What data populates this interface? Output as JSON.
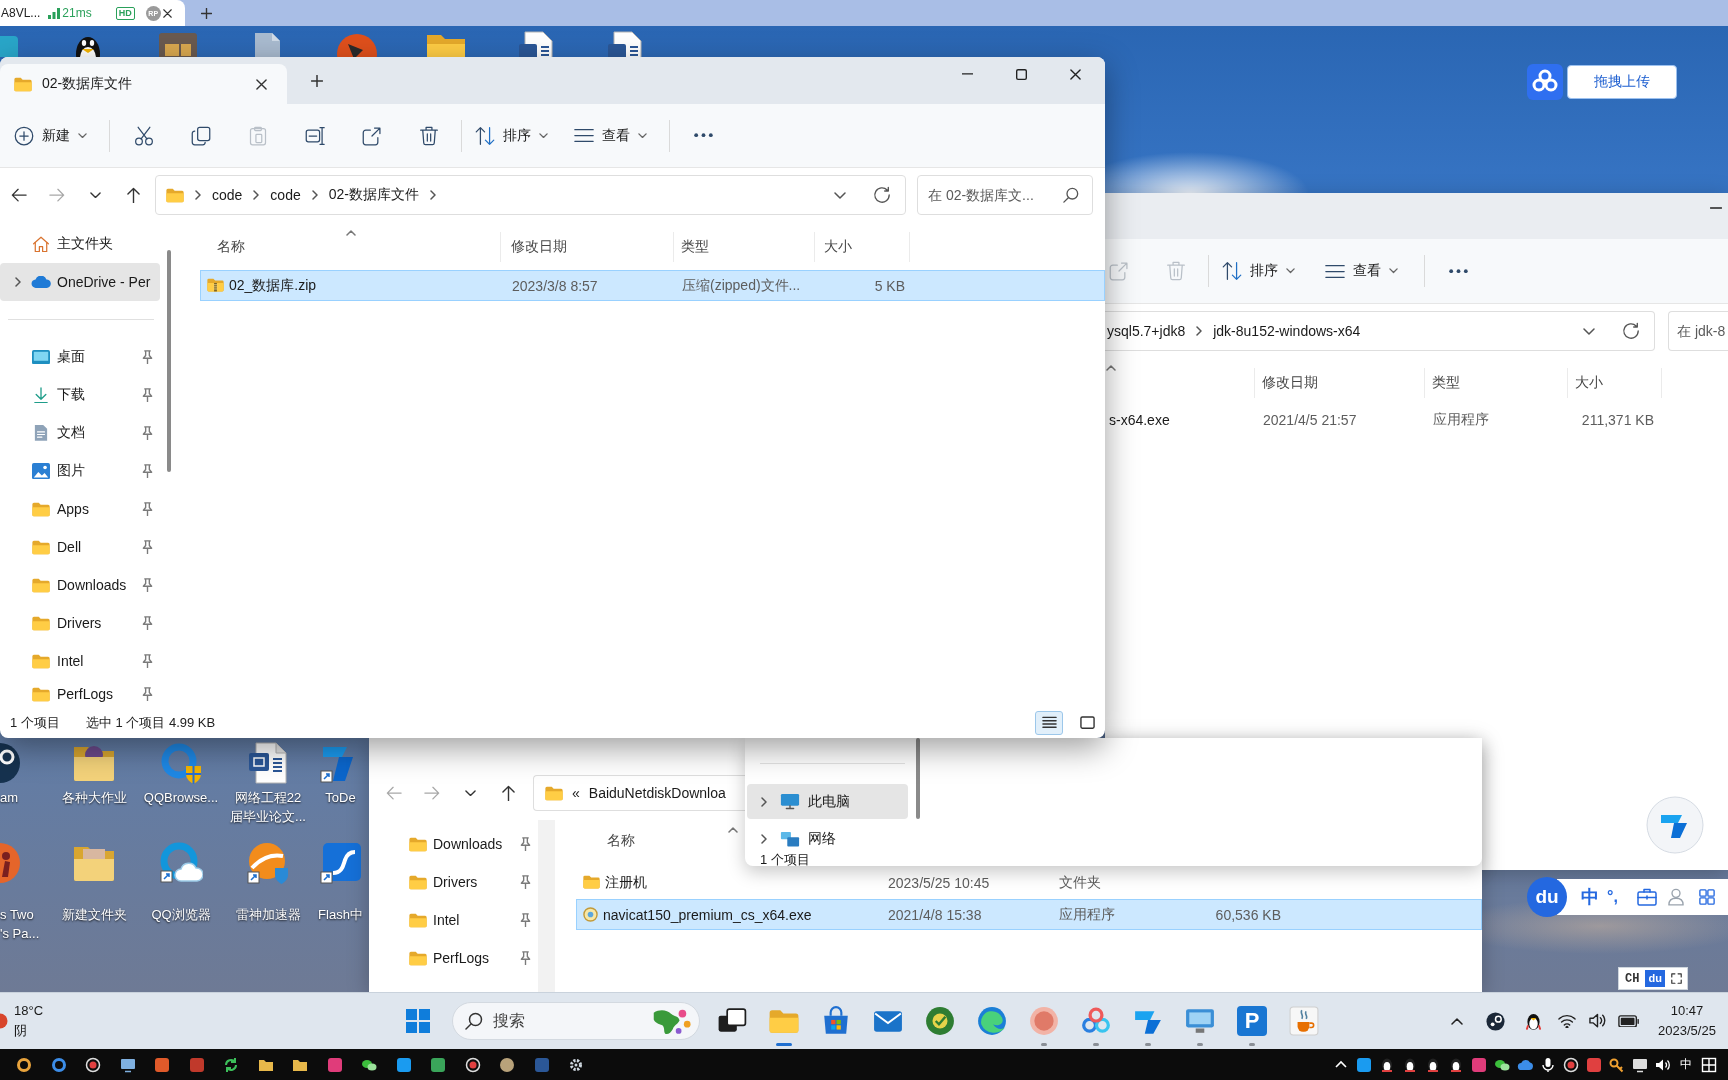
{
  "browser_tab": {
    "title": "A8VL...",
    "latency": "21ms",
    "badge": "HD",
    "avatar": "RP"
  },
  "desktop_icons": [
    {
      "lines": [
        "am"
      ]
    },
    {
      "lines": [
        "各种大作业"
      ]
    },
    {
      "lines": [
        "QQBrowse..."
      ]
    },
    {
      "lines": [
        "网络工程22",
        "届毕业论文..."
      ]
    },
    {
      "lines": [
        "ToDe"
      ]
    },
    {
      "lines": [
        "s Two",
        "'s Pa..."
      ]
    },
    {
      "lines": [
        "新建文件夹"
      ]
    },
    {
      "lines": [
        "QQ浏览器"
      ]
    },
    {
      "lines": [
        "雷神加速器"
      ]
    },
    {
      "lines": [
        "Flash中"
      ]
    }
  ],
  "upload_widget": {
    "label": "拖拽上传"
  },
  "main_window": {
    "tab": {
      "title": "02-数据库文件",
      "selected": true
    },
    "toolbar": [
      {
        "kind": "menu",
        "label": "新建",
        "disabled": false
      },
      {
        "kind": "separator"
      },
      {
        "kind": "icon",
        "disabled": false
      },
      {
        "kind": "icon",
        "disabled": false
      },
      {
        "kind": "icon",
        "disabled": true
      },
      {
        "kind": "icon",
        "disabled": false
      },
      {
        "kind": "icon",
        "disabled": false
      },
      {
        "kind": "icon",
        "disabled": false
      },
      {
        "kind": "separator"
      },
      {
        "kind": "menu",
        "label": "排序",
        "disabled": false
      },
      {
        "kind": "menu",
        "label": "查看",
        "disabled": false
      },
      {
        "kind": "separator"
      },
      {
        "kind": "icon",
        "disabled": false
      }
    ],
    "nav": [
      {
        "disabled": false
      },
      {
        "disabled": true
      },
      {
        "disabled": false
      },
      {
        "disabled": false
      }
    ],
    "address": {
      "crumbs": [
        "code",
        "code",
        "02-数据库文件"
      ]
    },
    "search": {
      "placeholder": "在 02-数据库文..."
    },
    "sidebar": [
      {
        "kind": "plain",
        "label": "主文件夹",
        "selected": false
      },
      {
        "kind": "tree",
        "label": "OneDrive - Per",
        "selected": true
      },
      {
        "kind": "divider"
      },
      {
        "kind": "pinned",
        "label": "桌面",
        "selected": false
      },
      {
        "kind": "pinned",
        "label": "下载",
        "selected": false
      },
      {
        "kind": "pinned",
        "label": "文档",
        "selected": false
      },
      {
        "kind": "pinned",
        "label": "图片",
        "selected": false
      },
      {
        "kind": "pinned",
        "label": "Apps",
        "selected": false
      },
      {
        "kind": "pinned",
        "label": "Dell",
        "selected": false
      },
      {
        "kind": "pinned",
        "label": "Downloads",
        "selected": false
      },
      {
        "kind": "pinned",
        "label": "Drivers",
        "selected": false
      },
      {
        "kind": "pinned",
        "label": "Intel",
        "selected": false
      },
      {
        "kind": "pinned",
        "label": "PerfLogs",
        "selected": false
      }
    ],
    "columns": [
      {
        "label": "名称",
        "sorted": true
      },
      {
        "label": "修改日期",
        "sorted": false
      },
      {
        "label": "类型",
        "sorted": false
      },
      {
        "label": "大小",
        "sorted": false
      }
    ],
    "rows": [
      {
        "name": "02_数据库.zip",
        "date": "2023/3/8 8:57",
        "type": "压缩(zipped)文件...",
        "size": "5 KB",
        "selected": true
      }
    ],
    "status": {
      "count": "1 个项目",
      "selection": "选中 1 个项目 4.99 KB"
    },
    "view_modes": [
      {
        "selected": true
      },
      {
        "selected": false
      }
    ]
  },
  "jdk_window": {
    "toolbar": [
      {
        "kind": "icon",
        "disabled": true
      },
      {
        "kind": "icon",
        "disabled": true
      },
      {
        "kind": "separator"
      },
      {
        "kind": "menu",
        "label": "排序",
        "disabled": false
      },
      {
        "kind": "menu",
        "label": "查看",
        "disabled": false
      },
      {
        "kind": "separator"
      },
      {
        "kind": "icon",
        "disabled": false
      }
    ],
    "address": {
      "crumbs": [
        "ysql5.7+jdk8",
        "jdk-8u152-windows-x64"
      ]
    },
    "search": {
      "placeholder": "在 jdk-8"
    },
    "columns": [
      {
        "sorted": true
      },
      {
        "label": "修改日期",
        "sorted": false
      },
      {
        "label": "类型",
        "sorted": false
      },
      {
        "label": "大小",
        "sorted": false
      }
    ],
    "rows": [
      {
        "name": "s-x64.exe",
        "date": "2021/4/5 21:57",
        "type": "应用程序",
        "size": "211,371 KB",
        "selected": false
      }
    ]
  },
  "baidu_window": {
    "nav": [
      {
        "disabled": true
      },
      {
        "disabled": true
      },
      {
        "disabled": false
      },
      {
        "disabled": false
      }
    ],
    "address": {
      "prefix": "«",
      "crumbs": [
        "BaiduNetdiskDownloa"
      ]
    },
    "sidebar": [
      {
        "label": "Downloads",
        "selected": false
      },
      {
        "label": "Drivers",
        "selected": false
      },
      {
        "label": "Intel",
        "selected": false
      },
      {
        "label": "PerfLogs",
        "selected": false
      }
    ],
    "columns": [
      {
        "label": "名称",
        "sorted": true
      }
    ],
    "rows": [
      {
        "kind": "folder",
        "name": "注册机",
        "date": "2023/5/25 10:45",
        "type": "文件夹",
        "selected": false
      },
      {
        "kind": "file",
        "name": "navicat150_premium_cs_x64.exe",
        "date": "2021/4/8 15:38",
        "type": "应用程序",
        "size": "60,536 KB",
        "selected": true
      }
    ]
  },
  "pc_window": {
    "sidebar": [
      {
        "label": "此电脑",
        "selected": true
      },
      {
        "label": "网络",
        "selected": false
      }
    ],
    "status": {
      "count": "1 个项目"
    }
  },
  "ime_bar": {
    "logo": "du",
    "mode": "中",
    "punctuation": "°,"
  },
  "ime_mini": {
    "language": "CH",
    "logo": "du"
  },
  "taskbar": {
    "weather": {
      "temperature": "18°C",
      "condition": "阴"
    },
    "search": {
      "placeholder": "搜索"
    },
    "apps": [
      {
        "running": false,
        "active": false
      },
      {
        "running": true,
        "active": true
      },
      {
        "running": false,
        "active": false
      },
      {
        "running": false,
        "active": false
      },
      {
        "running": false,
        "active": false
      },
      {
        "running": false,
        "active": false
      },
      {
        "running": true,
        "active": false
      },
      {
        "running": true,
        "active": false
      },
      {
        "running": true,
        "active": false
      },
      {
        "running": true,
        "active": false
      },
      {
        "running": true,
        "active": false,
        "glyph": "P"
      },
      {
        "running": false,
        "active": false
      }
    ],
    "clock": {
      "time": "10:47",
      "date": "2023/5/25"
    }
  },
  "host_taskbar": {
    "ime": "中"
  }
}
